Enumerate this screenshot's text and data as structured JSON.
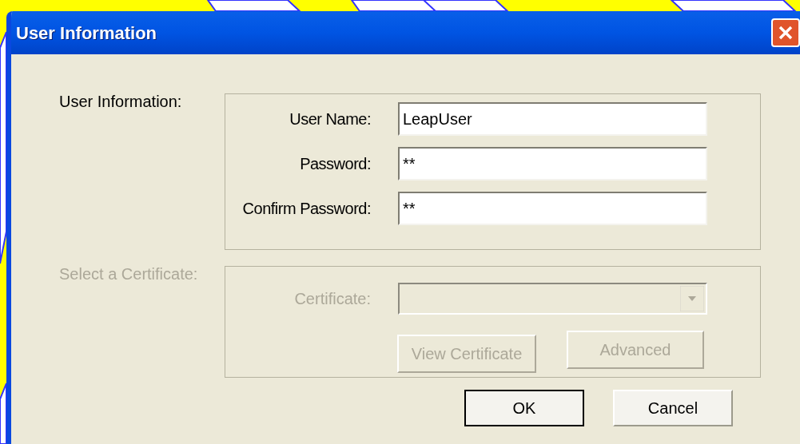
{
  "window": {
    "title": "User Information"
  },
  "user_section": {
    "label": "User Information:",
    "disabled": false,
    "fields": [
      {
        "label": "User Name:",
        "value": "LeapUser"
      },
      {
        "label": "Password:",
        "value": "**"
      },
      {
        "label": "Confirm Password:",
        "value": "**"
      }
    ]
  },
  "certificate_section": {
    "label": "Select a Certificate:",
    "disabled": true,
    "dropdown": {
      "label": "Certificate:"
    },
    "buttons": [
      {
        "label": "View Certificate",
        "disabled": true
      },
      {
        "label": "Advanced",
        "disabled": true
      }
    ]
  },
  "buttons": [
    {
      "label": "OK",
      "default": true
    },
    {
      "label": "Cancel",
      "default": false
    }
  ]
}
